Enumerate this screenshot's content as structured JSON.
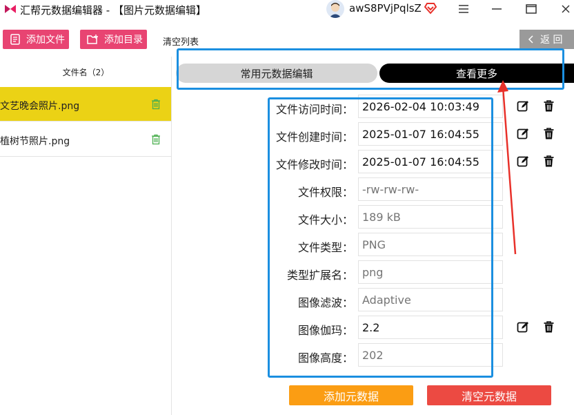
{
  "window": {
    "title": "汇帮元数据编辑器 - 【图片元数据编辑】",
    "user_name": "awS8PVjPqlsZ"
  },
  "toolbar": {
    "add_file": "添加文件",
    "add_dir": "添加目录",
    "clear_list": "清空列表",
    "back": "返 回"
  },
  "file_panel": {
    "header": "文件名（2）",
    "files": [
      {
        "name": "文艺晚会照片.png"
      },
      {
        "name": "植树节照片.png"
      }
    ]
  },
  "tabs": {
    "common": "常用元数据编辑",
    "more": "查看更多"
  },
  "metadata": {
    "rows": [
      {
        "label": "文件访问时间：",
        "value": "2026-02-04 10:03:49",
        "editable": true
      },
      {
        "label": "文件创建时间：",
        "value": "2025-01-07 16:04:55",
        "editable": true
      },
      {
        "label": "文件修改时间：",
        "value": "2025-01-07 16:04:55",
        "editable": true
      },
      {
        "label": "文件权限：",
        "placeholder": "-rw-rw-rw-",
        "editable": false
      },
      {
        "label": "文件大小：",
        "placeholder": "189 kB",
        "editable": false
      },
      {
        "label": "文件类型：",
        "placeholder": "PNG",
        "editable": false
      },
      {
        "label": "类型扩展名：",
        "placeholder": "png",
        "editable": false
      },
      {
        "label": "图像滤波：",
        "placeholder": "Adaptive",
        "editable": false
      },
      {
        "label": "图像伽玛：",
        "value": "2.2",
        "editable": true
      },
      {
        "label": "图像高度：",
        "placeholder": "202",
        "editable": false
      }
    ]
  },
  "buttons": {
    "add_metadata": "添加元数据",
    "clear_metadata": "清空元数据"
  },
  "colors": {
    "accent_pink": "#e84472",
    "selected_row": "#ebd215",
    "annotation_blue": "#1b8fe0",
    "annotation_arrow": "#e8312a",
    "add_button": "#fb9d13",
    "clear_button": "#ec4a42"
  }
}
